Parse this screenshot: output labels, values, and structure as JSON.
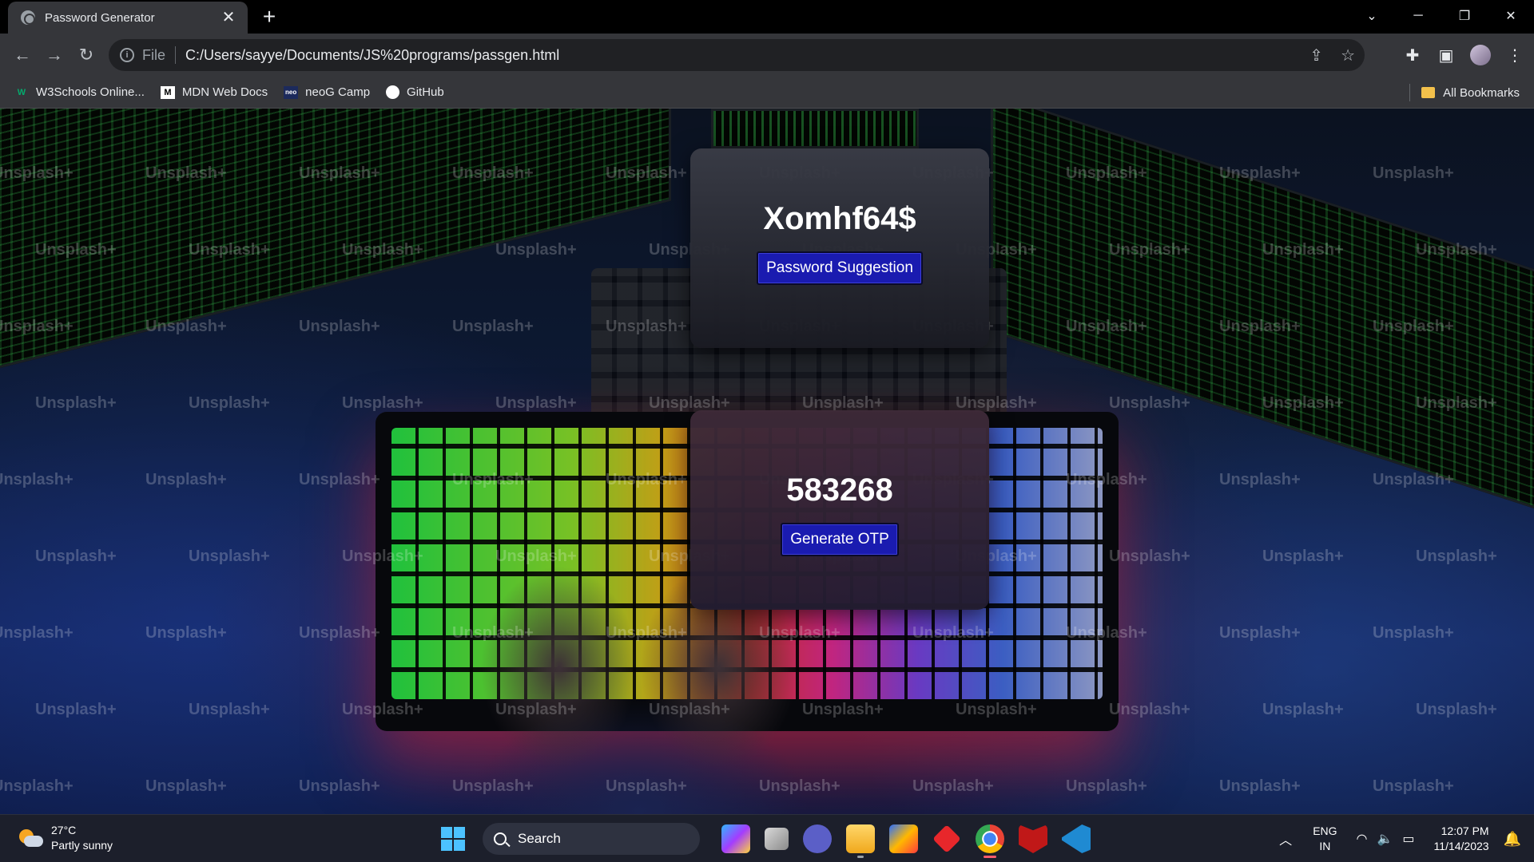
{
  "browser": {
    "tab_title": "Password Generator",
    "tab_close": "✕",
    "new_tab": "+",
    "url_scheme": "File",
    "url": "C:/Users/sayye/Documents/JS%20programs/passgen.html",
    "bookmarks": [
      {
        "label": "W3Schools Online...",
        "icon": "w3schools-icon"
      },
      {
        "label": "MDN Web Docs",
        "icon": "mdn-icon"
      },
      {
        "label": "neoG Camp",
        "icon": "neog-icon"
      },
      {
        "label": "GitHub",
        "icon": "github-icon"
      }
    ],
    "all_bookmarks": "All Bookmarks"
  },
  "page": {
    "password_value": "Xomhf64$",
    "password_button": "Password Suggestion",
    "otp_value": "583268",
    "otp_button": "Generate OTP",
    "watermark": "Unsplash+",
    "button_color": "#1a1bb0"
  },
  "taskbar": {
    "temperature": "27°C",
    "weather": "Partly sunny",
    "search": "Search",
    "lang_top": "ENG",
    "lang_bottom": "IN",
    "time": "12:07 PM",
    "date": "11/14/2023"
  }
}
